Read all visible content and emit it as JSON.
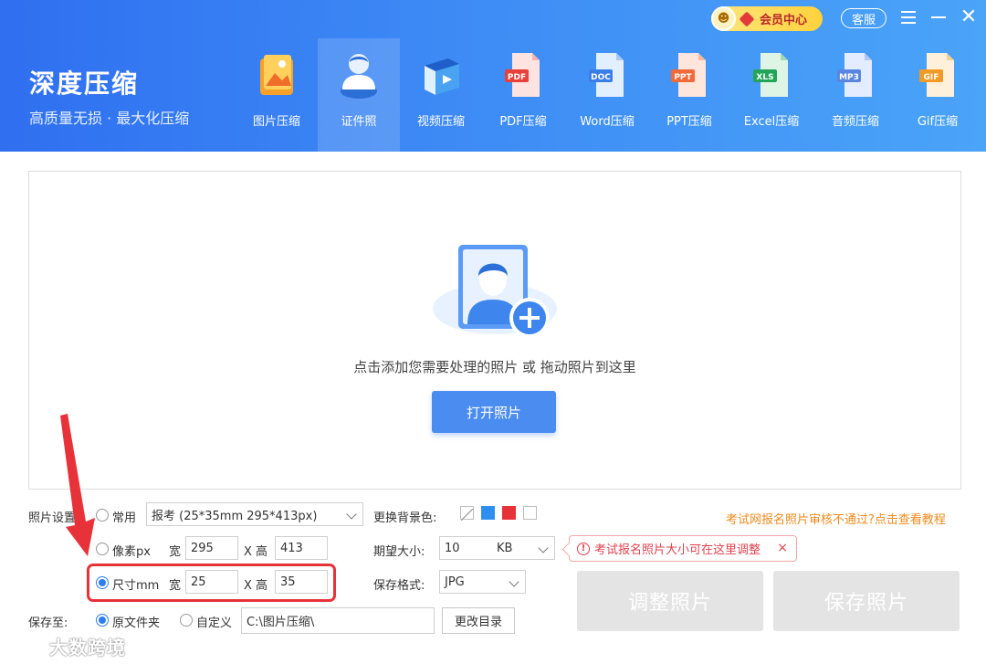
{
  "brand": {
    "title": "深度压缩",
    "subtitle": "高质量无损 · 最大化压缩"
  },
  "topbar": {
    "vip_label": "会员中心",
    "service_label": "客服"
  },
  "tabs": [
    {
      "label": "图片压缩",
      "icon": "image-icon"
    },
    {
      "label": "证件照",
      "icon": "id-photo-icon",
      "active": true
    },
    {
      "label": "视频压缩",
      "icon": "video-icon"
    },
    {
      "label": "PDF压缩",
      "icon": "pdf-icon",
      "badge": "PDF"
    },
    {
      "label": "Word压缩",
      "icon": "word-icon",
      "badge": "DOC"
    },
    {
      "label": "PPT压缩",
      "icon": "ppt-icon",
      "badge": "PPT"
    },
    {
      "label": "Excel压缩",
      "icon": "excel-icon",
      "badge": "XLS"
    },
    {
      "label": "音频压缩",
      "icon": "audio-icon",
      "badge": "MP3"
    },
    {
      "label": "Gif压缩",
      "icon": "gif-icon",
      "badge": "GIF"
    }
  ],
  "dropzone": {
    "hint": "点击添加您需要处理的照片 或 拖动照片到这里",
    "open_button": "打开照片"
  },
  "settings": {
    "photo_settings_label": "照片设置",
    "mode_common": "常用",
    "preset_value": "报考 (25*35mm 295*413px)",
    "mode_pixel": "像素px",
    "pixel_width_label": "宽",
    "pixel_width": "295",
    "pixel_height_label": "X 高",
    "pixel_height": "413",
    "mode_mm": "尺寸mm",
    "mm_width_label": "宽",
    "mm_width": "25",
    "mm_height_label": "X 高",
    "mm_height": "35",
    "selected_mode": "mm",
    "bg_color_label": "更换背景色:",
    "bg_colors": [
      "none",
      "#2f8ef0",
      "#e8323a",
      "#ffffff"
    ],
    "expected_size_label": "期望大小:",
    "expected_size": "10",
    "expected_size_unit": "KB",
    "save_format_label": "保存格式:",
    "save_format": "JPG",
    "save_to_label": "保存至:",
    "save_original": "原文件夹",
    "save_custom": "自定义",
    "save_path": "C:\\图片压缩\\",
    "change_dir_button": "更改目录"
  },
  "help_link": "考试网报名照片审核不通过?点击查看教程",
  "tip": {
    "text": "考试报名照片大小可在这里调整",
    "close": "×"
  },
  "actions": {
    "adjust": "调整照片",
    "save": "保存照片"
  },
  "watermark": {
    "text": "大数跨境"
  },
  "colors": {
    "accent": "#4a8cf0",
    "header_start": "#2f6ff0",
    "header_end": "#4aa4f8",
    "annotation": "#e8323a",
    "link": "#f08a1c"
  }
}
